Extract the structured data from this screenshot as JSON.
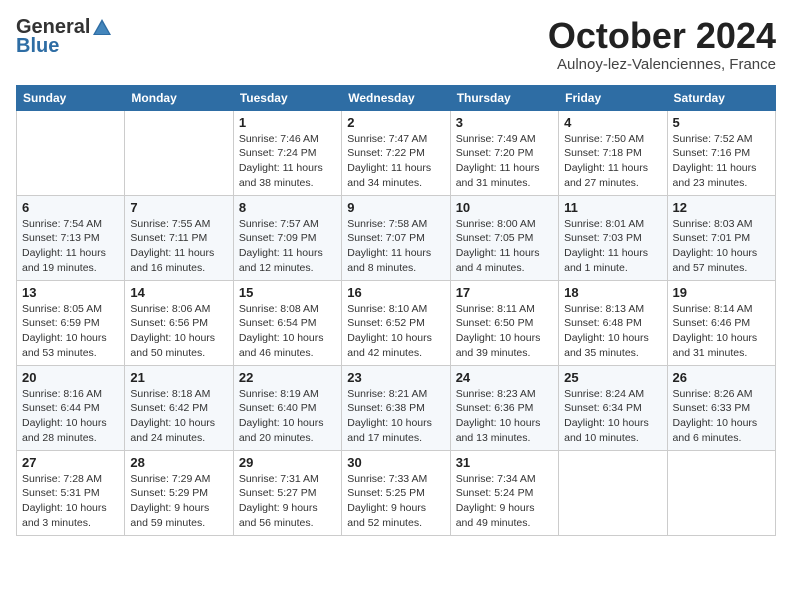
{
  "header": {
    "logo_general": "General",
    "logo_blue": "Blue",
    "month_title": "October 2024",
    "location": "Aulnoy-lez-Valenciennes, France"
  },
  "weekdays": [
    "Sunday",
    "Monday",
    "Tuesday",
    "Wednesday",
    "Thursday",
    "Friday",
    "Saturday"
  ],
  "weeks": [
    [
      {
        "day": null
      },
      {
        "day": null
      },
      {
        "day": "1",
        "sunrise": "Sunrise: 7:46 AM",
        "sunset": "Sunset: 7:24 PM",
        "daylight": "Daylight: 11 hours and 38 minutes."
      },
      {
        "day": "2",
        "sunrise": "Sunrise: 7:47 AM",
        "sunset": "Sunset: 7:22 PM",
        "daylight": "Daylight: 11 hours and 34 minutes."
      },
      {
        "day": "3",
        "sunrise": "Sunrise: 7:49 AM",
        "sunset": "Sunset: 7:20 PM",
        "daylight": "Daylight: 11 hours and 31 minutes."
      },
      {
        "day": "4",
        "sunrise": "Sunrise: 7:50 AM",
        "sunset": "Sunset: 7:18 PM",
        "daylight": "Daylight: 11 hours and 27 minutes."
      },
      {
        "day": "5",
        "sunrise": "Sunrise: 7:52 AM",
        "sunset": "Sunset: 7:16 PM",
        "daylight": "Daylight: 11 hours and 23 minutes."
      }
    ],
    [
      {
        "day": "6",
        "sunrise": "Sunrise: 7:54 AM",
        "sunset": "Sunset: 7:13 PM",
        "daylight": "Daylight: 11 hours and 19 minutes."
      },
      {
        "day": "7",
        "sunrise": "Sunrise: 7:55 AM",
        "sunset": "Sunset: 7:11 PM",
        "daylight": "Daylight: 11 hours and 16 minutes."
      },
      {
        "day": "8",
        "sunrise": "Sunrise: 7:57 AM",
        "sunset": "Sunset: 7:09 PM",
        "daylight": "Daylight: 11 hours and 12 minutes."
      },
      {
        "day": "9",
        "sunrise": "Sunrise: 7:58 AM",
        "sunset": "Sunset: 7:07 PM",
        "daylight": "Daylight: 11 hours and 8 minutes."
      },
      {
        "day": "10",
        "sunrise": "Sunrise: 8:00 AM",
        "sunset": "Sunset: 7:05 PM",
        "daylight": "Daylight: 11 hours and 4 minutes."
      },
      {
        "day": "11",
        "sunrise": "Sunrise: 8:01 AM",
        "sunset": "Sunset: 7:03 PM",
        "daylight": "Daylight: 11 hours and 1 minute."
      },
      {
        "day": "12",
        "sunrise": "Sunrise: 8:03 AM",
        "sunset": "Sunset: 7:01 PM",
        "daylight": "Daylight: 10 hours and 57 minutes."
      }
    ],
    [
      {
        "day": "13",
        "sunrise": "Sunrise: 8:05 AM",
        "sunset": "Sunset: 6:59 PM",
        "daylight": "Daylight: 10 hours and 53 minutes."
      },
      {
        "day": "14",
        "sunrise": "Sunrise: 8:06 AM",
        "sunset": "Sunset: 6:56 PM",
        "daylight": "Daylight: 10 hours and 50 minutes."
      },
      {
        "day": "15",
        "sunrise": "Sunrise: 8:08 AM",
        "sunset": "Sunset: 6:54 PM",
        "daylight": "Daylight: 10 hours and 46 minutes."
      },
      {
        "day": "16",
        "sunrise": "Sunrise: 8:10 AM",
        "sunset": "Sunset: 6:52 PM",
        "daylight": "Daylight: 10 hours and 42 minutes."
      },
      {
        "day": "17",
        "sunrise": "Sunrise: 8:11 AM",
        "sunset": "Sunset: 6:50 PM",
        "daylight": "Daylight: 10 hours and 39 minutes."
      },
      {
        "day": "18",
        "sunrise": "Sunrise: 8:13 AM",
        "sunset": "Sunset: 6:48 PM",
        "daylight": "Daylight: 10 hours and 35 minutes."
      },
      {
        "day": "19",
        "sunrise": "Sunrise: 8:14 AM",
        "sunset": "Sunset: 6:46 PM",
        "daylight": "Daylight: 10 hours and 31 minutes."
      }
    ],
    [
      {
        "day": "20",
        "sunrise": "Sunrise: 8:16 AM",
        "sunset": "Sunset: 6:44 PM",
        "daylight": "Daylight: 10 hours and 28 minutes."
      },
      {
        "day": "21",
        "sunrise": "Sunrise: 8:18 AM",
        "sunset": "Sunset: 6:42 PM",
        "daylight": "Daylight: 10 hours and 24 minutes."
      },
      {
        "day": "22",
        "sunrise": "Sunrise: 8:19 AM",
        "sunset": "Sunset: 6:40 PM",
        "daylight": "Daylight: 10 hours and 20 minutes."
      },
      {
        "day": "23",
        "sunrise": "Sunrise: 8:21 AM",
        "sunset": "Sunset: 6:38 PM",
        "daylight": "Daylight: 10 hours and 17 minutes."
      },
      {
        "day": "24",
        "sunrise": "Sunrise: 8:23 AM",
        "sunset": "Sunset: 6:36 PM",
        "daylight": "Daylight: 10 hours and 13 minutes."
      },
      {
        "day": "25",
        "sunrise": "Sunrise: 8:24 AM",
        "sunset": "Sunset: 6:34 PM",
        "daylight": "Daylight: 10 hours and 10 minutes."
      },
      {
        "day": "26",
        "sunrise": "Sunrise: 8:26 AM",
        "sunset": "Sunset: 6:33 PM",
        "daylight": "Daylight: 10 hours and 6 minutes."
      }
    ],
    [
      {
        "day": "27",
        "sunrise": "Sunrise: 7:28 AM",
        "sunset": "Sunset: 5:31 PM",
        "daylight": "Daylight: 10 hours and 3 minutes."
      },
      {
        "day": "28",
        "sunrise": "Sunrise: 7:29 AM",
        "sunset": "Sunset: 5:29 PM",
        "daylight": "Daylight: 9 hours and 59 minutes."
      },
      {
        "day": "29",
        "sunrise": "Sunrise: 7:31 AM",
        "sunset": "Sunset: 5:27 PM",
        "daylight": "Daylight: 9 hours and 56 minutes."
      },
      {
        "day": "30",
        "sunrise": "Sunrise: 7:33 AM",
        "sunset": "Sunset: 5:25 PM",
        "daylight": "Daylight: 9 hours and 52 minutes."
      },
      {
        "day": "31",
        "sunrise": "Sunrise: 7:34 AM",
        "sunset": "Sunset: 5:24 PM",
        "daylight": "Daylight: 9 hours and 49 minutes."
      },
      {
        "day": null
      },
      {
        "day": null
      }
    ]
  ]
}
